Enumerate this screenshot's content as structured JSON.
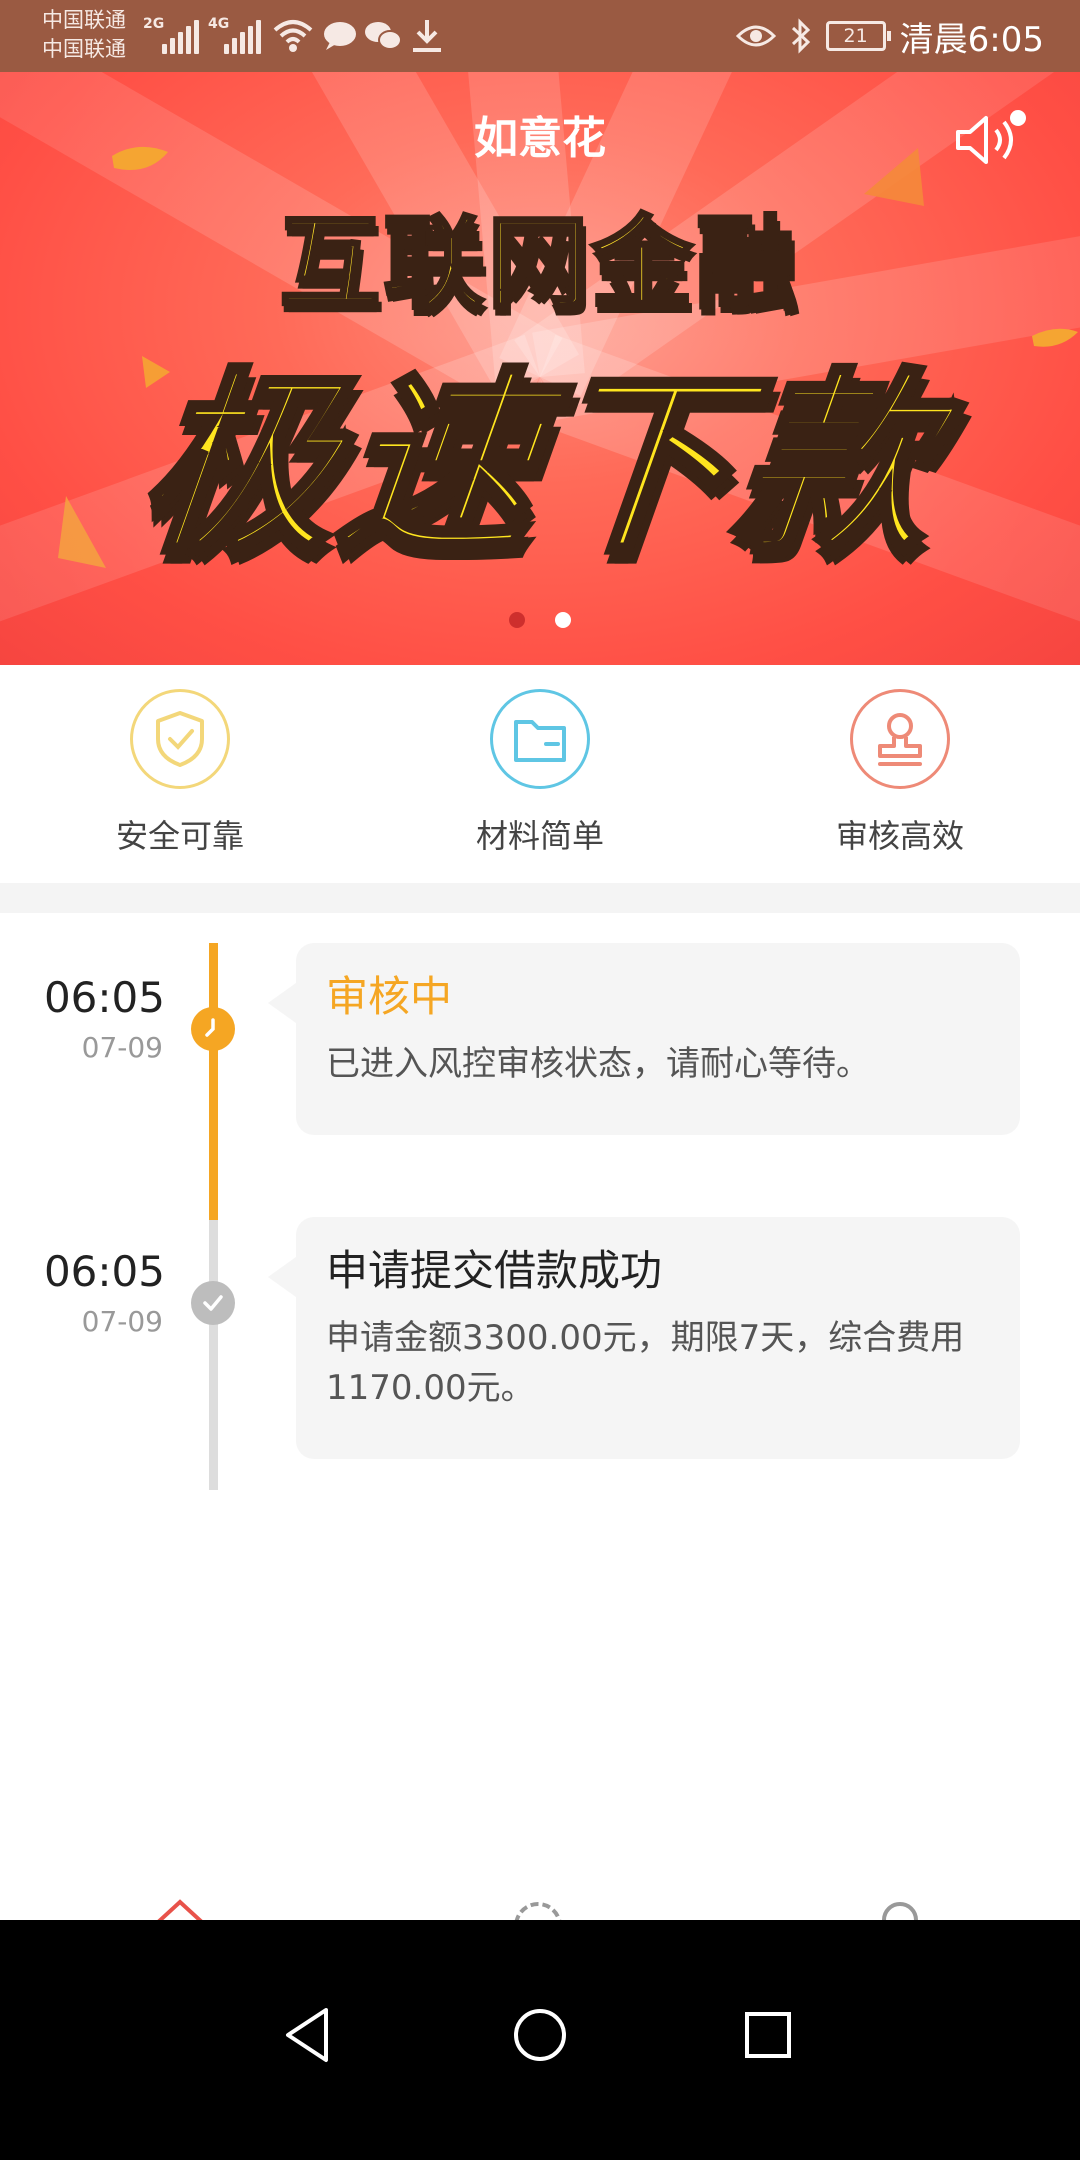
{
  "status_bar": {
    "carrier_1": "中国联通",
    "carrier_2": "中国联通",
    "network_1": "2G",
    "network_2": "4G",
    "battery": "21",
    "time": "清晨6:05",
    "icons": [
      "signal-icon",
      "wifi-icon",
      "message-icon",
      "wechat-icon",
      "download-icon",
      "eye-icon",
      "bluetooth-icon",
      "battery-icon"
    ]
  },
  "banner": {
    "title": "如意花",
    "headline_1": "互联网金融",
    "headline_2": "极速下款",
    "page_indicator": {
      "count": 2,
      "active": 0
    },
    "colors": {
      "background": "#ff5a4c",
      "headline": "#ffe12a",
      "outline": "#3a2214"
    }
  },
  "features": [
    {
      "label": "安全可靠",
      "icon": "shield-check-icon",
      "color": "#f3d77a"
    },
    {
      "label": "材料简单",
      "icon": "folder-icon",
      "color": "#5fc6e4"
    },
    {
      "label": "审核高效",
      "icon": "stamp-icon",
      "color": "#ee8a77"
    }
  ],
  "timeline": [
    {
      "time": "06:05",
      "date": "07-09",
      "title": "审核中",
      "description": "已进入风控审核状态，请耐心等待。",
      "status": "pending",
      "color": "#f5a623"
    },
    {
      "time": "06:05",
      "date": "07-09",
      "title": "申请提交借款成功",
      "description": "申请金额3300.00元，期限7天，综合费用1170.00元。",
      "status": "done",
      "color": "#bdbdbd"
    }
  ],
  "tab_bar": {
    "icons": [
      "home-icon",
      "settings-icon",
      "user-icon"
    ],
    "accent": "#e8524a"
  },
  "nav_bar": {
    "buttons": [
      "back-icon",
      "home-icon",
      "recents-icon"
    ]
  }
}
